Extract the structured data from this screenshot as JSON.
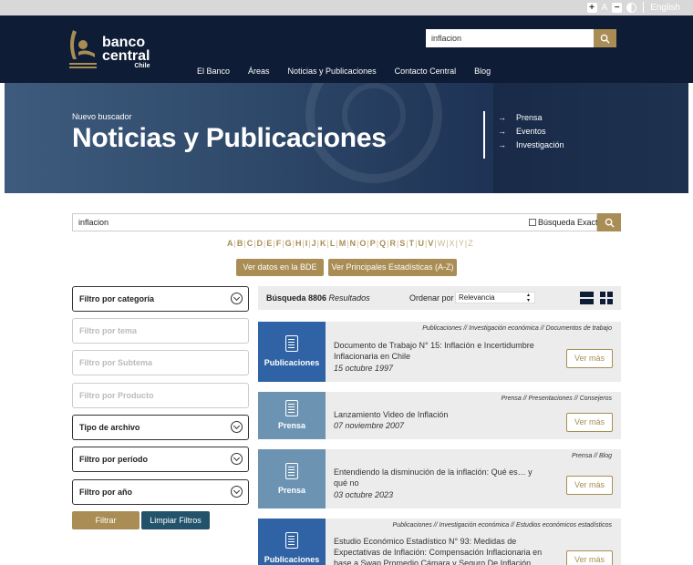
{
  "topbar": {
    "font_small": "A",
    "language": "English"
  },
  "logo": {
    "line1": "banco",
    "line2": "central",
    "line3": "Chile"
  },
  "header_search": {
    "value": "inflacion"
  },
  "nav": [
    "El Banco",
    "Áreas",
    "Noticias y Publicaciones",
    "Contacto Central",
    "Blog"
  ],
  "hero": {
    "subtitle": "Nuevo buscador",
    "title": "Noticias y Publicaciones",
    "links": [
      "Prensa",
      "Eventos",
      "Investigación"
    ]
  },
  "search": {
    "value": "inflacion",
    "exact_label": "Búsqueda Exacta"
  },
  "alphabet": [
    "A",
    "B",
    "C",
    "D",
    "E",
    "F",
    "G",
    "H",
    "I",
    "J",
    "K",
    "L",
    "M",
    "N",
    "O",
    "P",
    "Q",
    "R",
    "S",
    "T",
    "U",
    "V",
    "W",
    "X",
    "Y",
    "Z"
  ],
  "alphabet_dim": [
    "W",
    "X",
    "Y",
    "Z"
  ],
  "buttons": {
    "bde": "Ver datos en la BDE",
    "stats": "Ver Principales Estadísticas (A-Z)",
    "filter": "Filtrar",
    "clear": "Limpiar Filtros"
  },
  "filters": [
    {
      "label": "Filtro por categoría",
      "type": "dropdown"
    },
    {
      "label": "Filtro por tema",
      "type": "disabled"
    },
    {
      "label": "Filtro por Subtema",
      "type": "disabled"
    },
    {
      "label": "Filtro por Producto",
      "type": "disabled"
    },
    {
      "label": "Tipo de archivo",
      "type": "dropdown"
    },
    {
      "label": "Filtro por período",
      "type": "dropdown"
    },
    {
      "label": "Filtro por año",
      "type": "dropdown"
    }
  ],
  "results": {
    "count_label": "Búsqueda 8806",
    "count_suffix": "Resultados",
    "order_label": "Ordenar por",
    "order_value": "Relevancia"
  },
  "cards": [
    {
      "badge": "Publicaciones",
      "color": "#2f63a6",
      "category": "Publicaciones // Investigación económica // Documentos de trabajo",
      "title": "Documento de Trabajo N° 15: Inflación e Incertidumbre Inflacionaria en Chile",
      "date": "15 octubre 1997",
      "more": "Ver más"
    },
    {
      "badge": "Prensa",
      "color": "#6d93b3",
      "category": "Prensa // Presentaciones // Consejeros",
      "title": "Lanzamiento Video de Inflación",
      "date": "07 noviembre 2007",
      "more": "Ver más"
    },
    {
      "badge": "Prensa",
      "color": "#6d93b3",
      "category": "Prensa // Blog",
      "title": "Entendiendo la disminución de la inflación: Qué es… y qué no",
      "date": "03 octubre 2023",
      "more": "Ver más"
    },
    {
      "badge": "Publicaciones",
      "color": "#2f63a6",
      "category": "Publicaciones // Investigación económica // Estudios económicos estadísticos",
      "title": "Estudio Económico Estadístico N° 93: Medidas de Expectativas de Inflación: Compensación Inflacionaria en base a Swap Promedio Cámara y Seguro De Inflación",
      "date": "",
      "more": "Ver más"
    }
  ]
}
